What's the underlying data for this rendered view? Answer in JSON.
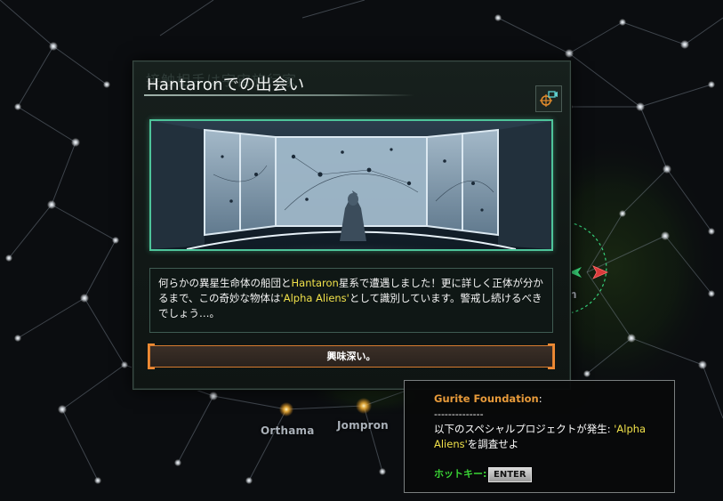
{
  "map": {
    "systems": [
      {
        "name": "Orthama"
      },
      {
        "name": "Jompron"
      }
    ],
    "partial_label": "n"
  },
  "dialog": {
    "ghost_title": "接触相手は宇宙旅行家",
    "title": "Hantaronでの出会い",
    "camera_icon": "camera-target-icon",
    "body": {
      "part1": "何らかの異星生命体の船団と",
      "highlight1": "Hantaron",
      "part2": "星系で遭遇しました！更に詳しく正体が分かるまで、この奇妙な物体は",
      "highlight2": "'Alpha Aliens'",
      "part3": "として識別しています。警戒し続けるべきでしょう…。"
    },
    "ok_button": "興味深い。"
  },
  "tooltip": {
    "owner": "Gurite Foundation",
    "owner_suffix": ":",
    "divider": "--------------",
    "message_prefix": "以下のスペシャルプロジェクトが発生: ",
    "message_highlight": "'Alpha Aliens'",
    "message_suffix": "を調査せよ",
    "hotkey_label": "ホットキー:",
    "hotkey_key": "ENTER"
  },
  "colors": {
    "accent_green": "#4ec49a",
    "highlight_yellow": "#f0e14a",
    "owner_orange": "#e79a3a",
    "button_border": "#d67b2f",
    "hotkey_green": "#39d334"
  }
}
